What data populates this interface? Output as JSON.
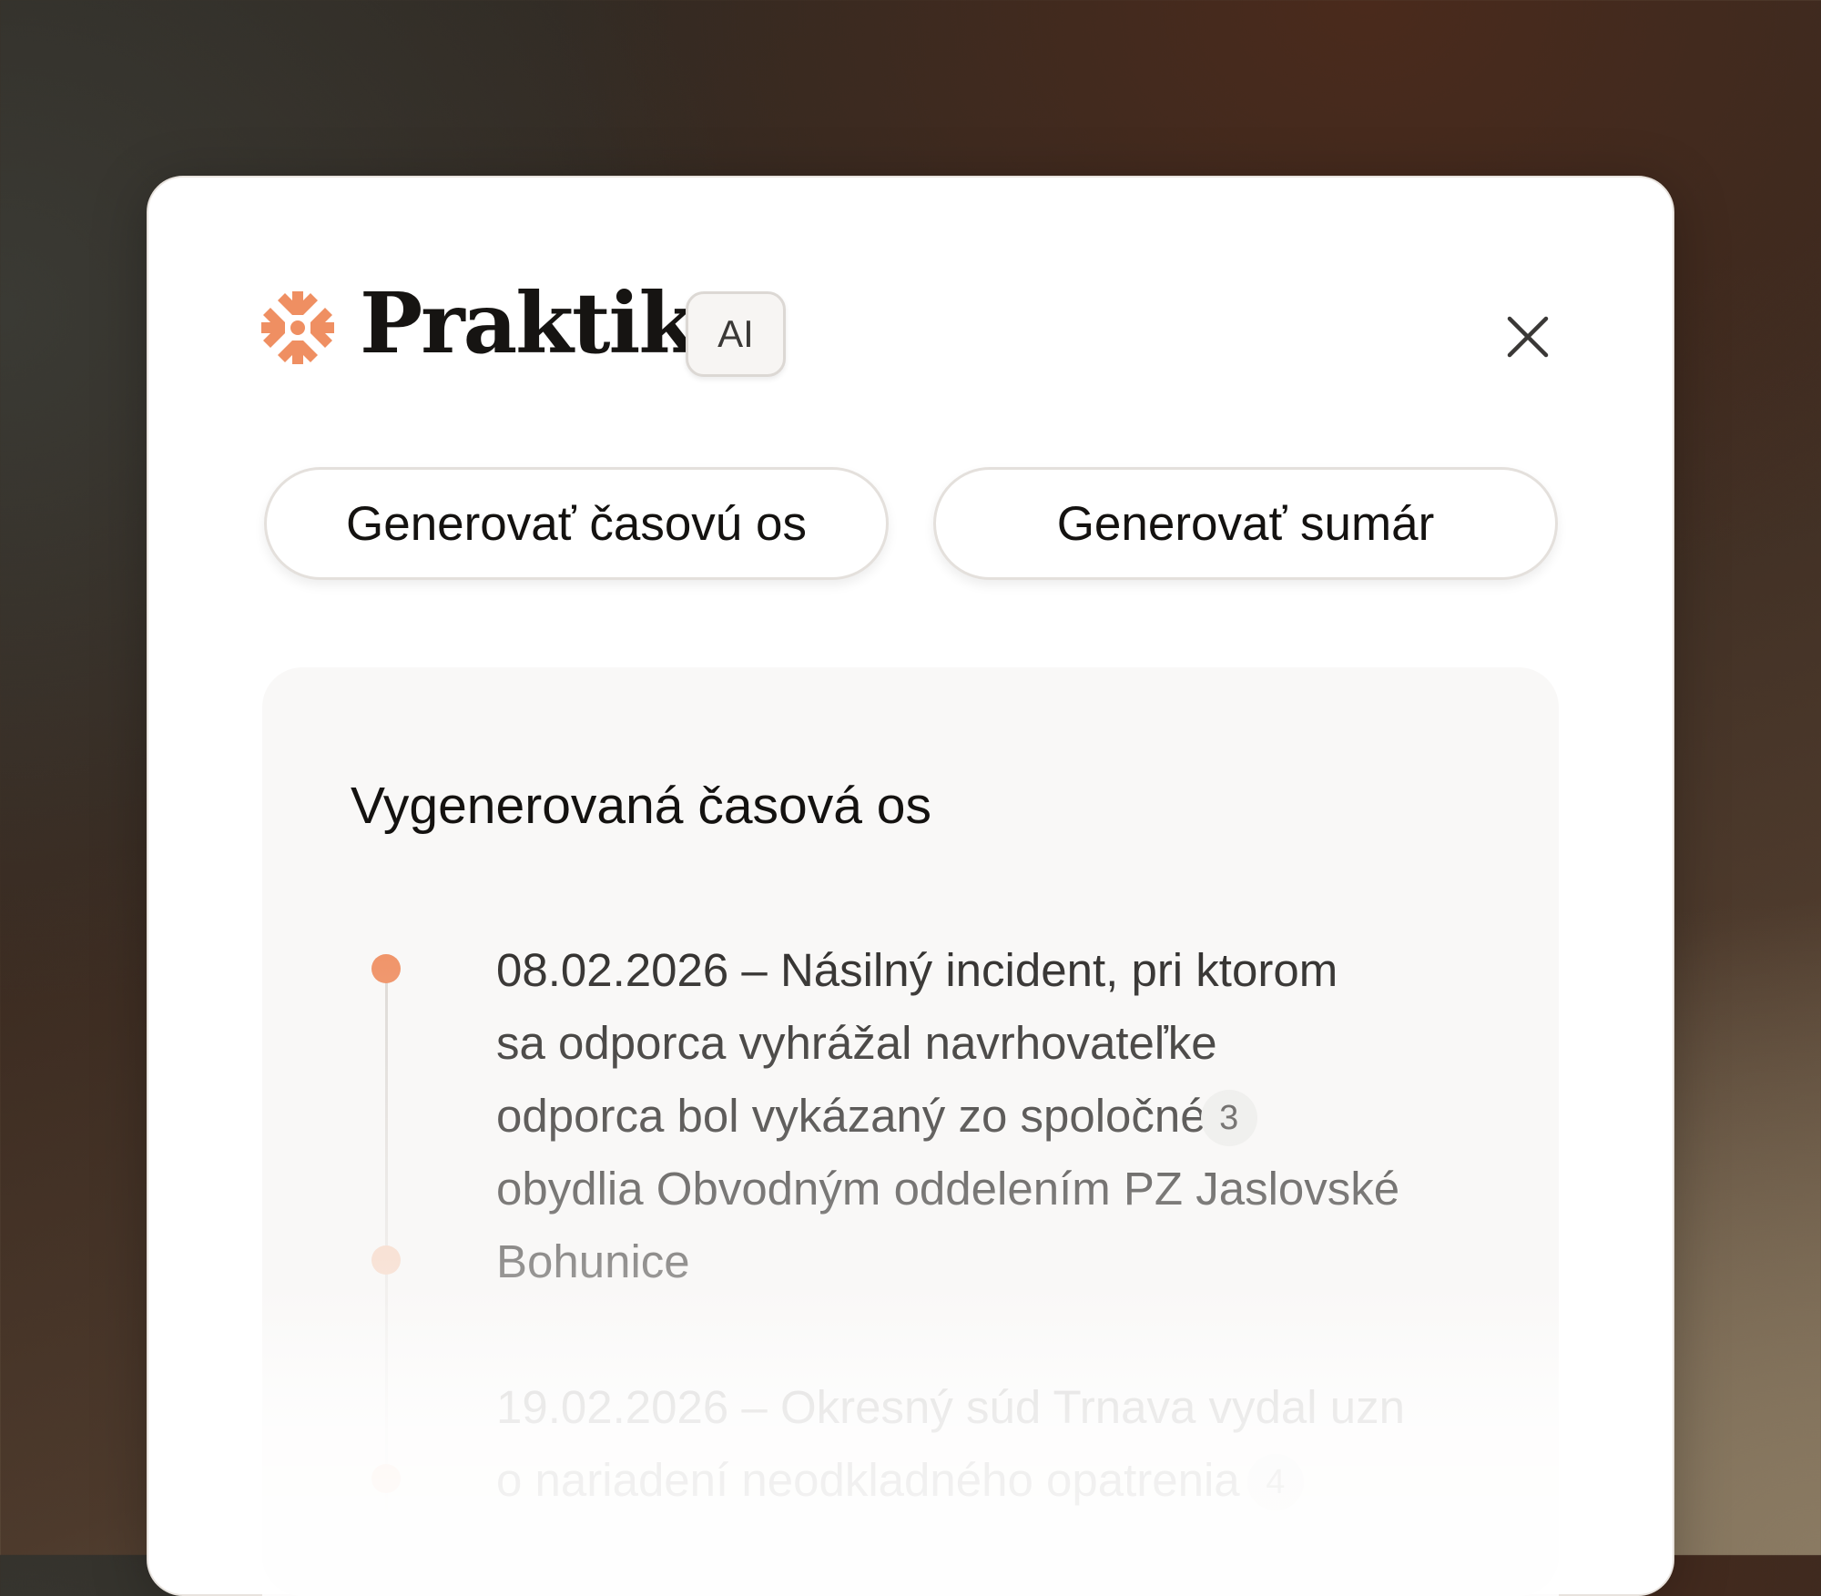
{
  "header": {
    "brand": "Praktik",
    "badge": "AI",
    "close_icon": "close-icon",
    "logo_icon": "sunburst-logo-icon",
    "accent_color": "#ef8f62"
  },
  "actions": {
    "timeline_label": "Generovať časovú os",
    "summary_label": "Generovať sumár"
  },
  "timeline": {
    "title": "Vygenerovaná časová os",
    "entries": [
      {
        "lines": [
          "08.02.2026 – Násilný incident, pri ktorom",
          "sa odporca vyhrážal navrhovateľke",
          "odporca bol vykázaný zo spoločné",
          "obydlia Obvodným oddelením PZ Jaslovské",
          "Bohunice"
        ],
        "ref": "3"
      },
      {
        "lines": [
          "19.02.2026 – Okresný súd Trnava vydal uzn",
          "o nariadení neodkladného opatrenia"
        ],
        "ref": "4"
      }
    ]
  }
}
